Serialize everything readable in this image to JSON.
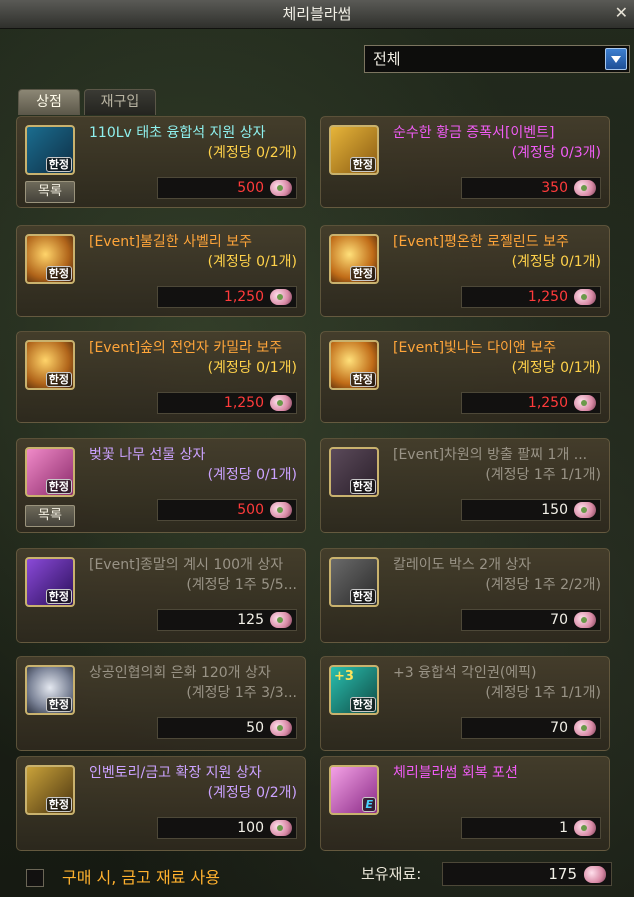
{
  "window": {
    "title": "체리블라썸",
    "close_icon": "close-icon"
  },
  "filter": {
    "selected": "전체"
  },
  "tabs": [
    {
      "label": "상점"
    },
    {
      "label": "재구입"
    }
  ],
  "items": [
    {
      "name": "110Lv 태초 융합석 지원 상자",
      "limit": "(계정당 0/2개)",
      "price": "500",
      "badge": "한정",
      "list_label": "목록",
      "icon": "box-icon"
    },
    {
      "name": "순수한 황금 증폭서[이벤트]",
      "limit": "(계정당 0/3개)",
      "price": "350",
      "badge": "한정",
      "icon": "scroll-icon"
    },
    {
      "name": "[Event]불길한 사벨리 보주",
      "limit": "(계정당 0/1개)",
      "price": "1,250",
      "badge": "한정",
      "icon": "orb-icon"
    },
    {
      "name": "[Event]평온한 로젤린드 보주",
      "limit": "(계정당 0/1개)",
      "price": "1,250",
      "badge": "한정",
      "icon": "orb-icon"
    },
    {
      "name": "[Event]숲의 전언자 카밀라 보주",
      "limit": "(계정당 0/1개)",
      "price": "1,250",
      "badge": "한정",
      "icon": "orb-icon"
    },
    {
      "name": "[Event]빛나는 다이앤 보주",
      "limit": "(계정당 0/1개)",
      "price": "1,250",
      "badge": "한정",
      "icon": "orb-icon"
    },
    {
      "name": "벚꽃 나무 선물 상자",
      "limit": "(계정당 0/1개)",
      "price": "500",
      "badge": "한정",
      "list_label": "목록",
      "icon": "gift-box-icon"
    },
    {
      "name": "[Event]차원의 방출 팔찌 1개 ...",
      "limit": "(계정당 1주 1/1개)",
      "price": "150",
      "badge": "한정",
      "icon": "bracelet-icon"
    },
    {
      "name": "[Event]종말의 계시 100개 상자",
      "limit": "(계정당 1주 5/5...",
      "price": "125",
      "badge": "한정",
      "icon": "crystal-icon"
    },
    {
      "name": "칼레이도 박스 2개 상자",
      "limit": "(계정당 1주 2/2개)",
      "price": "70",
      "badge": "한정",
      "icon": "kaleido-box-icon"
    },
    {
      "name": "상공인협의회 은화 120개 상자",
      "limit": "(계정당 1주 3/3...",
      "price": "50",
      "badge": "한정",
      "icon": "coin-icon"
    },
    {
      "name": "+3 융합석 각인권(에픽)",
      "limit": "(계정당 1주 1/1개)",
      "price": "70",
      "badge": "한정",
      "plus": "+3",
      "icon": "engrave-ticket-icon"
    },
    {
      "name": "인벤토리/금고 확장 지원 상자",
      "limit": "(계정당 0/2개)",
      "price": "100",
      "badge": "한정",
      "icon": "chest-icon"
    },
    {
      "name": "체리블라썸 회복 포션",
      "limit": "",
      "price": "1",
      "badge": "E",
      "icon": "potion-icon"
    }
  ],
  "footer": {
    "use_vault_label": "구매 시, 금고 재료 사용",
    "owned_label": "보유재료:",
    "owned_value": "175"
  },
  "colors": {
    "cyan": "#8ef0ee",
    "orange": "#ffa53a",
    "magenta": "#f05cf5",
    "violet": "#cba2ff",
    "gray": "#999386",
    "gold": "#ffd24a",
    "red": "#ff3b3b"
  }
}
